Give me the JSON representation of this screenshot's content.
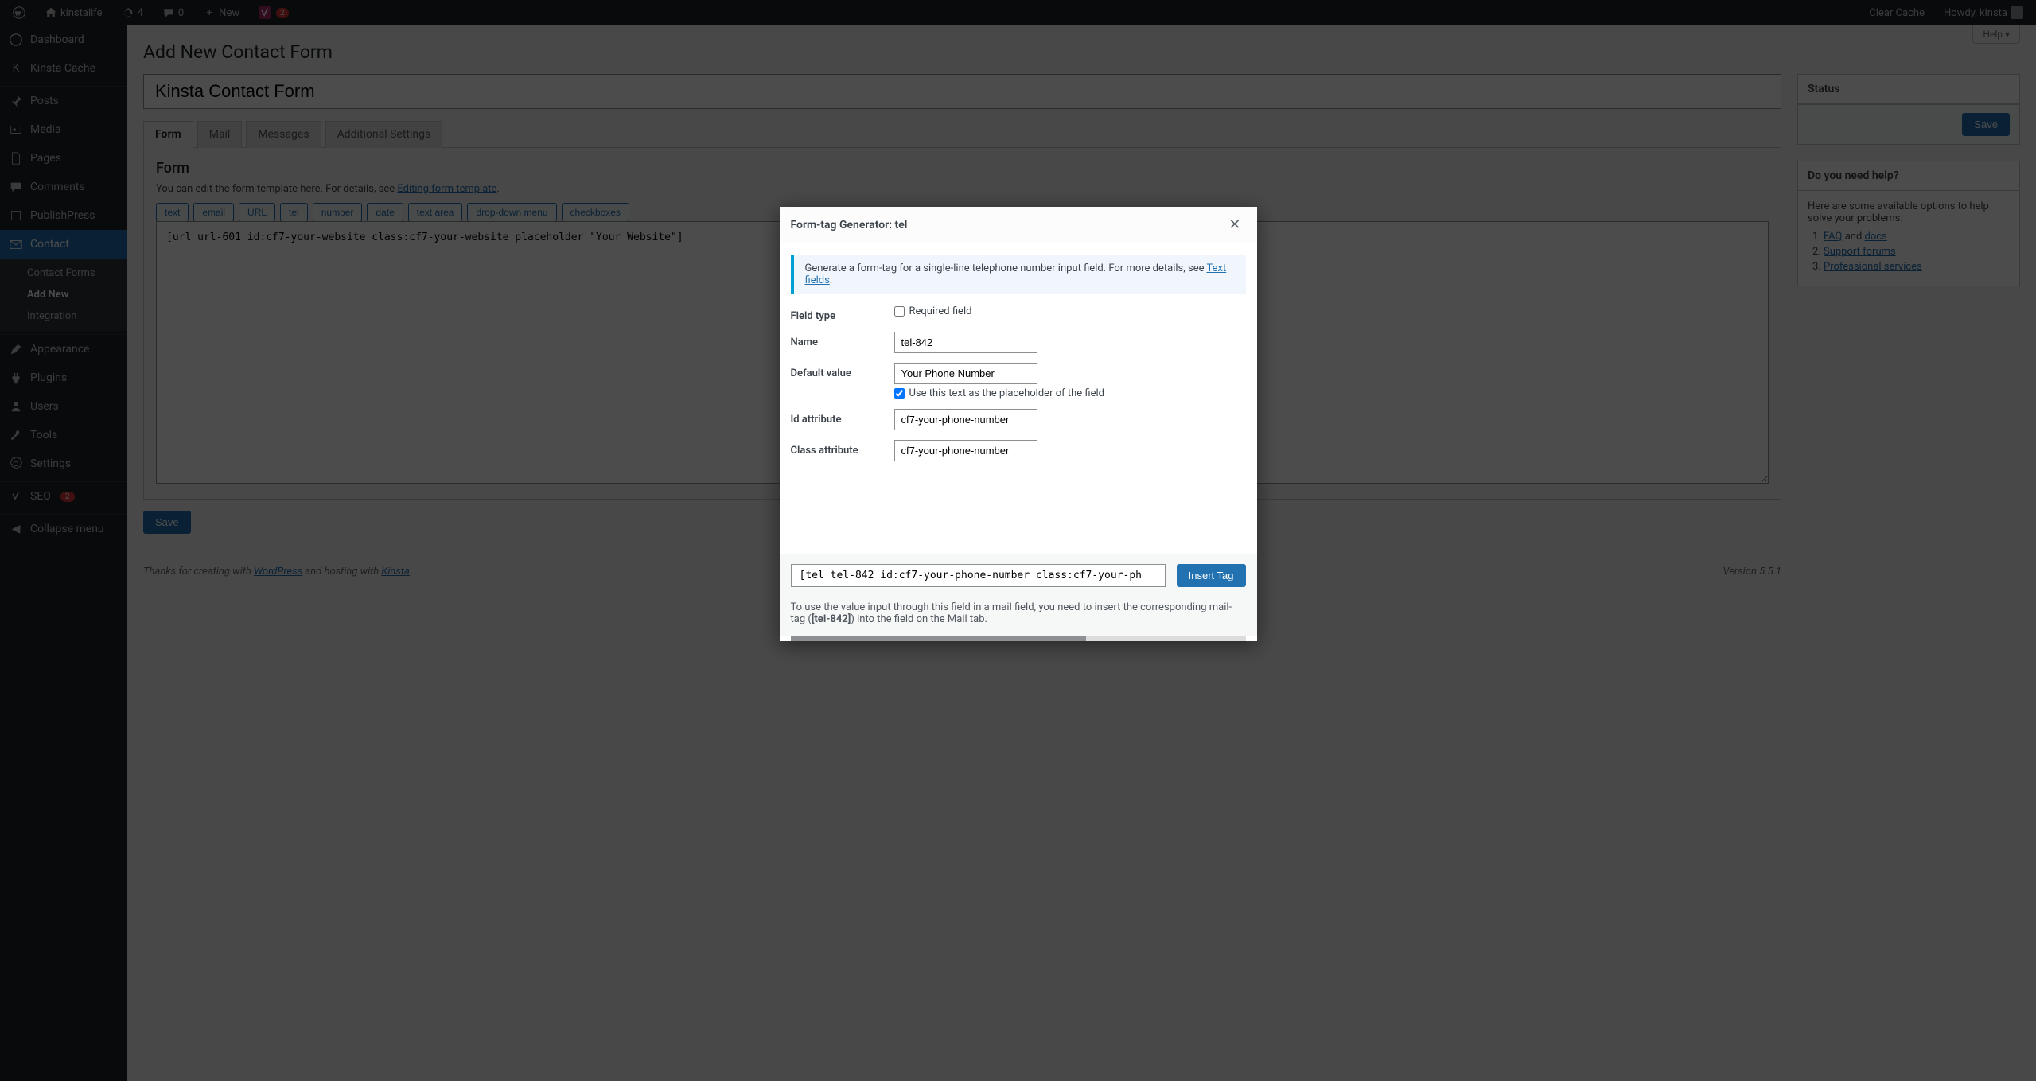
{
  "adminBar": {
    "siteName": "kinstalife",
    "updates": "4",
    "comments": "0",
    "new": "New",
    "yoastBadge": "2",
    "clearCache": "Clear Cache",
    "howdy": "Howdy, kinsta"
  },
  "sidebar": {
    "dashboard": "Dashboard",
    "kinstaCache": "Kinsta Cache",
    "posts": "Posts",
    "media": "Media",
    "pages": "Pages",
    "comments": "Comments",
    "publish": "PublishPress",
    "contact": "Contact",
    "contactSub": {
      "forms": "Contact Forms",
      "addNew": "Add New",
      "integration": "Integration"
    },
    "appearance": "Appearance",
    "plugins": "Plugins",
    "users": "Users",
    "tools": "Tools",
    "settings": "Settings",
    "seo": "SEO",
    "seoBadge": "2",
    "collapse": "Collapse menu"
  },
  "helpTab": "Help ▾",
  "pageTitle": "Add New Contact Form",
  "formTitleValue": "Kinsta Contact Form",
  "tabs": {
    "form": "Form",
    "mail": "Mail",
    "messages": "Messages",
    "extra": "Additional Settings"
  },
  "formPanel": {
    "heading": "Form",
    "descPre": "You can edit the form template here. For details, see ",
    "descLink": "Editing form template",
    "tagButtons": [
      "text",
      "email",
      "URL",
      "tel",
      "number",
      "date",
      "text area",
      "drop-down menu",
      "checkboxes"
    ],
    "codeValue": "[url url-601 id:cf7-your-website class:cf7-your-website placeholder \"Your Website\"]"
  },
  "saveBtn": "Save",
  "statusBox": {
    "title": "Status",
    "save": "Save"
  },
  "helpBox": {
    "title": "Do you need help?",
    "intro": "Here are some available options to help solve your problems.",
    "faq": "FAQ",
    "and": " and ",
    "docs": "docs",
    "support": "Support forums",
    "pro": "Professional services"
  },
  "footer": {
    "thanks": "Thanks for creating with ",
    "wordpress": "WordPress",
    "hosting": " and hosting with ",
    "kinsta": "Kinsta",
    "version": "Version 5.5.1"
  },
  "modal": {
    "title": "Form-tag Generator: tel",
    "infoPre": "Generate a form-tag for a single-line telephone number input field. For more details, see ",
    "infoLink": "Text fields",
    "fields": {
      "fieldType": "Field type",
      "required": "Required field",
      "name": "Name",
      "nameVal": "tel-842",
      "default": "Default value",
      "defaultVal": "Your Phone Number",
      "placeholderChk": "Use this text as the placeholder of the field",
      "id": "Id attribute",
      "idVal": "cf7-your-phone-number",
      "class": "Class attribute",
      "classVal": "cf7-your-phone-number"
    },
    "codePreview": "[tel tel-842 id:cf7-your-phone-number class:cf7-your-ph",
    "insertBtn": "Insert Tag",
    "notePre": "To use the value input through this field in a mail field, you need to insert the corresponding mail-tag (",
    "noteTag": "[tel-842]",
    "notePost": ") into the field on the Mail tab."
  }
}
